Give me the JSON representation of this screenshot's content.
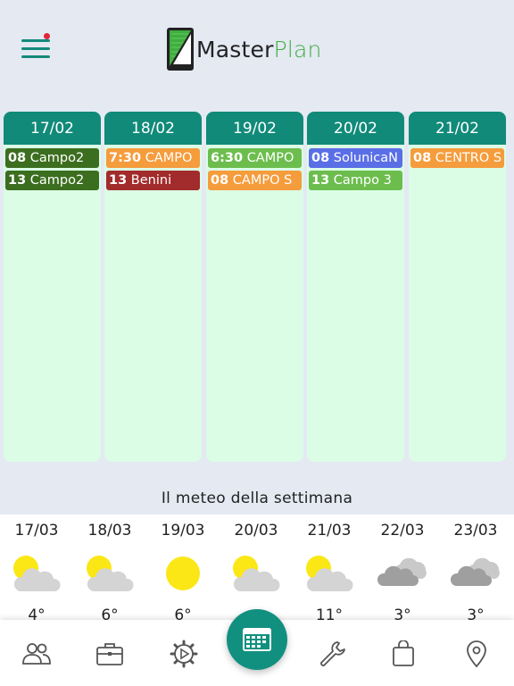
{
  "app": {
    "logo_main": "Master",
    "logo_accent": "Plan",
    "accent_color": "#118a79",
    "notification_color": "#e0243a"
  },
  "calendar": {
    "days": [
      {
        "date": "17/02",
        "events": [
          {
            "time": "08",
            "title": "Campo2",
            "color": "#3c6e1f"
          },
          {
            "time": "13",
            "title": "Campo2",
            "color": "#3c6e1f"
          }
        ]
      },
      {
        "date": "18/02",
        "events": [
          {
            "time": "7:30",
            "title": "CAMPO",
            "color": "#f59c3c"
          },
          {
            "time": "13",
            "title": "Benini",
            "color": "#a22c2b"
          }
        ]
      },
      {
        "date": "19/02",
        "events": [
          {
            "time": "6:30",
            "title": "CAMPO",
            "color": "#6cbd4d"
          },
          {
            "time": "08",
            "title": "CAMPO S",
            "color": "#f59c3c"
          }
        ]
      },
      {
        "date": "20/02",
        "events": [
          {
            "time": "08",
            "title": "SolunicaN",
            "color": "#5a6ee6"
          },
          {
            "time": "13",
            "title": "Campo 3",
            "color": "#6cbd4d"
          }
        ]
      },
      {
        "date": "21/02",
        "events": [
          {
            "time": "08",
            "title": "CENTRO S",
            "color": "#f59c3c"
          }
        ]
      }
    ]
  },
  "weather": {
    "title": "Il meteo della settimana",
    "days": [
      {
        "date": "17/03",
        "icon": "partly-cloudy-icon",
        "temp": "4°"
      },
      {
        "date": "18/03",
        "icon": "partly-cloudy-icon",
        "temp": "6°"
      },
      {
        "date": "19/03",
        "icon": "sun-icon",
        "temp": "6°"
      },
      {
        "date": "20/03",
        "icon": "partly-cloudy-icon",
        "temp": ""
      },
      {
        "date": "21/03",
        "icon": "partly-cloudy-icon",
        "temp": "11°"
      },
      {
        "date": "22/03",
        "icon": "cloudy-icon",
        "temp": "3°"
      },
      {
        "date": "23/03",
        "icon": "cloudy-icon",
        "temp": "3°"
      }
    ]
  },
  "nav": {
    "items": [
      {
        "icon": "people-icon"
      },
      {
        "icon": "briefcase-icon"
      },
      {
        "icon": "gear-play-icon"
      },
      {
        "icon": "calendar-icon"
      },
      {
        "icon": "wrench-icon"
      },
      {
        "icon": "shopping-bag-icon"
      },
      {
        "icon": "location-pin-icon"
      }
    ]
  }
}
